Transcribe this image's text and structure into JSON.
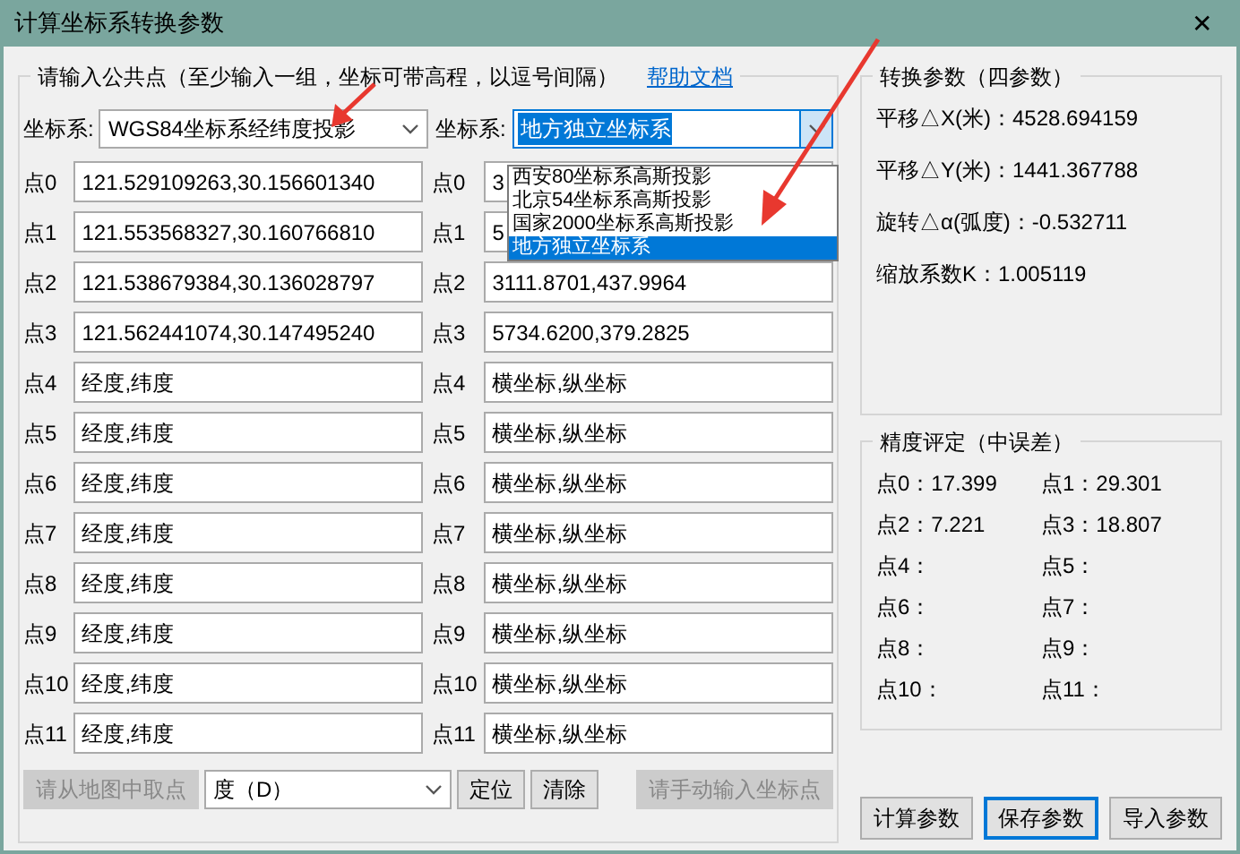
{
  "window": {
    "title": "计算坐标系转换参数",
    "close": "✕"
  },
  "input_group": {
    "title": "请输入公共点（至少输入一组，坐标可带高程，以逗号间隔）",
    "help_link": "帮助文档",
    "source_system": {
      "label": "坐标系:",
      "value": "WGS84坐标系经纬度投影"
    },
    "target_system": {
      "label": "坐标系:",
      "value": "地方独立坐标系",
      "expanded": true,
      "options": [
        {
          "label": "西安80坐标系高斯投影",
          "selected": false
        },
        {
          "label": "北京54坐标系高斯投影",
          "selected": false
        },
        {
          "label": "国家2000坐标系高斯投影",
          "selected": false
        },
        {
          "label": "地方独立坐标系",
          "selected": true
        }
      ]
    },
    "points": [
      {
        "source_label": "点0",
        "source": "121.529109263,30.156601340",
        "target_label": "点0",
        "target": "3"
      },
      {
        "source_label": "点1",
        "source": "121.553568327,30.160766810",
        "target_label": "点1",
        "target": "5"
      },
      {
        "source_label": "点2",
        "source": "121.538679384,30.136028797",
        "target_label": "点2",
        "target": "3111.8701,437.9964"
      },
      {
        "source_label": "点3",
        "source": "121.562441074,30.147495240",
        "target_label": "点3",
        "target": "5734.6200,379.2825"
      },
      {
        "source_label": "点4",
        "source": "经度,纬度",
        "target_label": "点4",
        "target": "横坐标,纵坐标"
      },
      {
        "source_label": "点5",
        "source": "经度,纬度",
        "target_label": "点5",
        "target": "横坐标,纵坐标"
      },
      {
        "source_label": "点6",
        "source": "经度,纬度",
        "target_label": "点6",
        "target": "横坐标,纵坐标"
      },
      {
        "source_label": "点7",
        "source": "经度,纬度",
        "target_label": "点7",
        "target": "横坐标,纵坐标"
      },
      {
        "source_label": "点8",
        "source": "经度,纬度",
        "target_label": "点8",
        "target": "横坐标,纵坐标"
      },
      {
        "source_label": "点9",
        "source": "经度,纬度",
        "target_label": "点9",
        "target": "横坐标,纵坐标"
      },
      {
        "source_label": "点10",
        "source": "经度,纬度",
        "target_label": "点10",
        "target": "横坐标,纵坐标"
      },
      {
        "source_label": "点11",
        "source": "经度,纬度",
        "target_label": "点11",
        "target": "横坐标,纵坐标"
      }
    ],
    "toolbar": [
      {
        "kind": "button",
        "label": "请从地图中取点",
        "disabled": true
      },
      {
        "kind": "combo",
        "label": "度（D）",
        "disabled": false
      },
      {
        "kind": "button",
        "label": "定位",
        "disabled": false
      },
      {
        "kind": "button",
        "label": "清除",
        "disabled": false
      },
      {
        "kind": "button",
        "label": "请手动输入坐标点",
        "disabled": true
      }
    ]
  },
  "parameters_group": {
    "title": "转换参数（四参数）",
    "items": [
      "平移△X(米)：4528.694159",
      "平移△Y(米)：1441.367788",
      "旋转△α(弧度)：-0.532711",
      "缩放系数K：1.005119"
    ]
  },
  "precision_group": {
    "title": "精度评定（中误差）",
    "items": [
      "点0：17.399",
      "点1：29.301",
      "点2：7.221",
      "点3：18.807",
      "点4：",
      "点5：",
      "点6：",
      "点7：",
      "点8：",
      "点9：",
      "点10：",
      "点11："
    ]
  },
  "buttons": [
    {
      "label": "计算参数",
      "focused": false
    },
    {
      "label": "保存参数",
      "focused": true
    },
    {
      "label": "导入参数",
      "focused": false
    }
  ]
}
